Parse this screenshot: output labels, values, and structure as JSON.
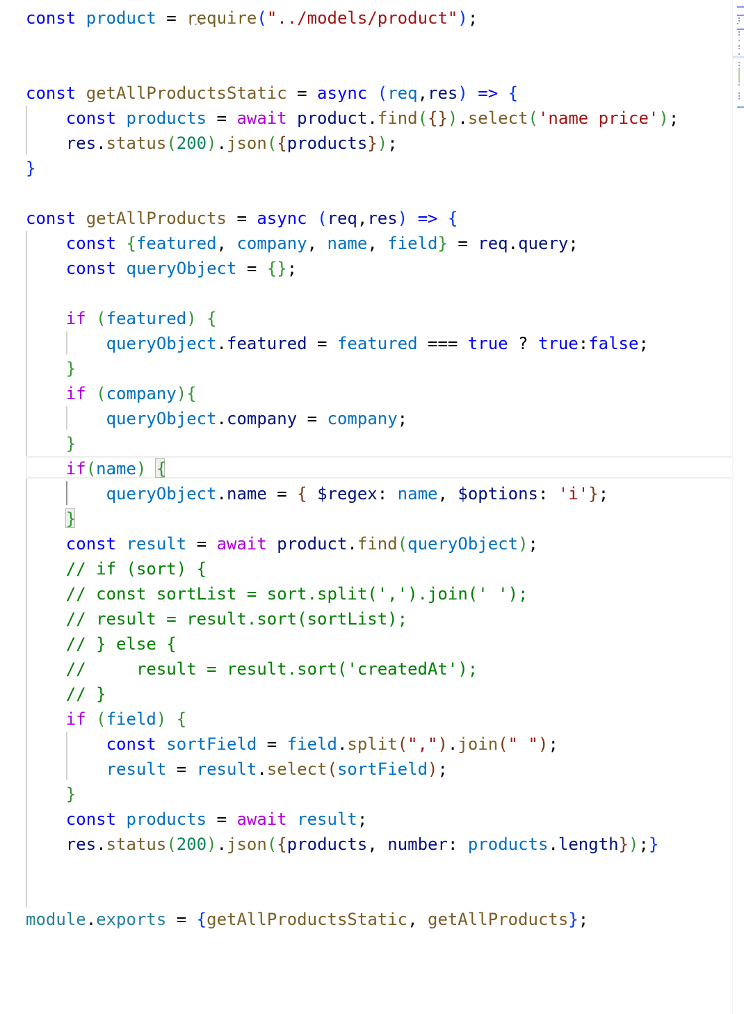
{
  "editor": {
    "language": "javascript",
    "theme_colors": {
      "keyword": "#0000ff",
      "control": "#af00db",
      "variable": "#0070c1",
      "property": "#001080",
      "function": "#795e26",
      "string": "#a31515",
      "number": "#098658",
      "comment": "#008000",
      "bracket_level1": "#0431fa",
      "bracket_level2": "#319331",
      "bracket_level3": "#7b3814",
      "module": "#267f99"
    },
    "hint_ellipsis": "...",
    "lines": [
      {
        "tokens": [
          [
            "kw",
            "const"
          ],
          [
            "p",
            " "
          ],
          [
            "var",
            "product"
          ],
          [
            "p",
            " = "
          ],
          [
            "fn",
            "require"
          ],
          [
            "br1",
            "("
          ],
          [
            "str",
            "\"../models/product\""
          ],
          [
            "br1",
            ")"
          ],
          [
            "p",
            ";"
          ]
        ]
      },
      {
        "tokens": []
      },
      {
        "tokens": []
      },
      {
        "tokens": [
          [
            "kw",
            "const"
          ],
          [
            "p",
            " "
          ],
          [
            "fn",
            "getAllProductsStatic"
          ],
          [
            "p",
            " = "
          ],
          [
            "kw",
            "async"
          ],
          [
            "p",
            " "
          ],
          [
            "br1",
            "("
          ],
          [
            "var",
            "req"
          ],
          [
            "p",
            ","
          ],
          [
            "vr2",
            "res"
          ],
          [
            "br1",
            ")"
          ],
          [
            "p",
            " "
          ],
          [
            "kw",
            "=>"
          ],
          [
            "p",
            " "
          ],
          [
            "br1",
            "{"
          ]
        ]
      },
      {
        "tokens": [
          [
            "p",
            "    "
          ],
          [
            "kw",
            "const"
          ],
          [
            "p",
            " "
          ],
          [
            "var",
            "products"
          ],
          [
            "p",
            " = "
          ],
          [
            "ctl",
            "await"
          ],
          [
            "p",
            " "
          ],
          [
            "vr2",
            "product"
          ],
          [
            "p",
            "."
          ],
          [
            "fn",
            "find"
          ],
          [
            "br2",
            "("
          ],
          [
            "br3",
            "{}"
          ],
          [
            "br2",
            ")"
          ],
          [
            "p",
            "."
          ],
          [
            "fn",
            "select"
          ],
          [
            "br2",
            "("
          ],
          [
            "str",
            "'name price'"
          ],
          [
            "br2",
            ")"
          ],
          [
            "p",
            ";"
          ]
        ]
      },
      {
        "tokens": [
          [
            "p",
            "    "
          ],
          [
            "vr2",
            "res"
          ],
          [
            "p",
            "."
          ],
          [
            "fn",
            "status"
          ],
          [
            "br2",
            "("
          ],
          [
            "num",
            "200"
          ],
          [
            "br2",
            ")"
          ],
          [
            "p",
            "."
          ],
          [
            "fn",
            "json"
          ],
          [
            "br2",
            "("
          ],
          [
            "br3",
            "{"
          ],
          [
            "vr2",
            "products"
          ],
          [
            "br3",
            "}"
          ],
          [
            "br2",
            ")"
          ],
          [
            "p",
            ";"
          ]
        ]
      },
      {
        "tokens": [
          [
            "br1",
            "}"
          ]
        ]
      },
      {
        "tokens": []
      },
      {
        "tokens": [
          [
            "kw",
            "const"
          ],
          [
            "p",
            " "
          ],
          [
            "fn",
            "getAllProducts"
          ],
          [
            "p",
            " = "
          ],
          [
            "kw",
            "async"
          ],
          [
            "p",
            " "
          ],
          [
            "br1",
            "("
          ],
          [
            "vr2",
            "req"
          ],
          [
            "p",
            ","
          ],
          [
            "vr2",
            "res"
          ],
          [
            "br1",
            ")"
          ],
          [
            "p",
            " "
          ],
          [
            "kw",
            "=>"
          ],
          [
            "p",
            " "
          ],
          [
            "br1",
            "{"
          ]
        ]
      },
      {
        "tokens": [
          [
            "p",
            "    "
          ],
          [
            "kw",
            "const"
          ],
          [
            "p",
            " "
          ],
          [
            "br2",
            "{"
          ],
          [
            "var",
            "featured"
          ],
          [
            "p",
            ", "
          ],
          [
            "var",
            "company"
          ],
          [
            "p",
            ", "
          ],
          [
            "var",
            "name"
          ],
          [
            "p",
            ", "
          ],
          [
            "var",
            "field"
          ],
          [
            "br2",
            "}"
          ],
          [
            "p",
            " = "
          ],
          [
            "vr2",
            "req"
          ],
          [
            "p",
            "."
          ],
          [
            "vr2",
            "query"
          ],
          [
            "p",
            ";"
          ]
        ]
      },
      {
        "tokens": [
          [
            "p",
            "    "
          ],
          [
            "kw",
            "const"
          ],
          [
            "p",
            " "
          ],
          [
            "var",
            "queryObject"
          ],
          [
            "p",
            " = "
          ],
          [
            "br2",
            "{}"
          ],
          [
            "p",
            ";"
          ]
        ]
      },
      {
        "tokens": []
      },
      {
        "tokens": [
          [
            "p",
            "    "
          ],
          [
            "ctl",
            "if"
          ],
          [
            "p",
            " "
          ],
          [
            "br2",
            "("
          ],
          [
            "var",
            "featured"
          ],
          [
            "br2",
            ")"
          ],
          [
            "p",
            " "
          ],
          [
            "br2",
            "{"
          ]
        ]
      },
      {
        "tokens": [
          [
            "p",
            "        "
          ],
          [
            "var",
            "queryObject"
          ],
          [
            "p",
            "."
          ],
          [
            "vr2",
            "featured"
          ],
          [
            "p",
            " = "
          ],
          [
            "var",
            "featured"
          ],
          [
            "p",
            " === "
          ],
          [
            "kw",
            "true"
          ],
          [
            "p",
            " ? "
          ],
          [
            "kw",
            "true"
          ],
          [
            "p",
            ":"
          ],
          [
            "kw",
            "false"
          ],
          [
            "p",
            ";"
          ]
        ]
      },
      {
        "tokens": [
          [
            "p",
            "    "
          ],
          [
            "br2",
            "}"
          ]
        ]
      },
      {
        "tokens": [
          [
            "p",
            "    "
          ],
          [
            "ctl",
            "if"
          ],
          [
            "p",
            " "
          ],
          [
            "br2",
            "("
          ],
          [
            "var",
            "company"
          ],
          [
            "br2",
            ")"
          ],
          [
            "br2",
            "{"
          ]
        ]
      },
      {
        "tokens": [
          [
            "p",
            "        "
          ],
          [
            "var",
            "queryObject"
          ],
          [
            "p",
            "."
          ],
          [
            "vr2",
            "company"
          ],
          [
            "p",
            " = "
          ],
          [
            "var",
            "company"
          ],
          [
            "p",
            ";"
          ]
        ]
      },
      {
        "tokens": [
          [
            "p",
            "    "
          ],
          [
            "br2",
            "}"
          ]
        ]
      },
      {
        "tokens": [
          [
            "p",
            "    "
          ],
          [
            "ctl",
            "if"
          ],
          [
            "br2",
            "("
          ],
          [
            "var",
            "name"
          ],
          [
            "br2",
            ")"
          ],
          [
            "p",
            " "
          ],
          [
            "br2",
            "{"
          ]
        ]
      },
      {
        "tokens": [
          [
            "p",
            "        "
          ],
          [
            "var",
            "queryObject"
          ],
          [
            "p",
            "."
          ],
          [
            "vr2",
            "name"
          ],
          [
            "p",
            " = "
          ],
          [
            "br3",
            "{"
          ],
          [
            "p",
            " "
          ],
          [
            "vr2",
            "$regex"
          ],
          [
            "p",
            ": "
          ],
          [
            "var",
            "name"
          ],
          [
            "p",
            ", "
          ],
          [
            "vr2",
            "$options"
          ],
          [
            "p",
            ": "
          ],
          [
            "str",
            "'i'"
          ],
          [
            "br3",
            "}"
          ],
          [
            "p",
            ";"
          ]
        ]
      },
      {
        "tokens": [
          [
            "p",
            "    "
          ],
          [
            "br2",
            "}"
          ]
        ]
      },
      {
        "tokens": [
          [
            "p",
            "    "
          ],
          [
            "kw",
            "const"
          ],
          [
            "p",
            " "
          ],
          [
            "var",
            "result"
          ],
          [
            "p",
            " = "
          ],
          [
            "ctl",
            "await"
          ],
          [
            "p",
            " "
          ],
          [
            "vr2",
            "product"
          ],
          [
            "p",
            "."
          ],
          [
            "fn",
            "find"
          ],
          [
            "br2",
            "("
          ],
          [
            "var",
            "queryObject"
          ],
          [
            "br2",
            ")"
          ],
          [
            "p",
            ";"
          ]
        ]
      },
      {
        "tokens": [
          [
            "p",
            "    "
          ],
          [
            "cmt",
            "// if (sort) {"
          ]
        ]
      },
      {
        "tokens": [
          [
            "p",
            "    "
          ],
          [
            "cmt",
            "// const sortList = sort.split(',').join(' ');"
          ]
        ]
      },
      {
        "tokens": [
          [
            "p",
            "    "
          ],
          [
            "cmt",
            "// result = result.sort(sortList);"
          ]
        ]
      },
      {
        "tokens": [
          [
            "p",
            "    "
          ],
          [
            "cmt",
            "// } else {"
          ]
        ]
      },
      {
        "tokens": [
          [
            "p",
            "    "
          ],
          [
            "cmt",
            "//     result = result.sort('createdAt');"
          ]
        ]
      },
      {
        "tokens": [
          [
            "p",
            "    "
          ],
          [
            "cmt",
            "// }"
          ]
        ]
      },
      {
        "tokens": [
          [
            "p",
            "    "
          ],
          [
            "ctl",
            "if"
          ],
          [
            "p",
            " "
          ],
          [
            "br2",
            "("
          ],
          [
            "var",
            "field"
          ],
          [
            "br2",
            ")"
          ],
          [
            "p",
            " "
          ],
          [
            "br2",
            "{"
          ]
        ]
      },
      {
        "tokens": [
          [
            "p",
            "        "
          ],
          [
            "kw",
            "const"
          ],
          [
            "p",
            " "
          ],
          [
            "var",
            "sortField"
          ],
          [
            "p",
            " = "
          ],
          [
            "var",
            "field"
          ],
          [
            "p",
            "."
          ],
          [
            "fn",
            "split"
          ],
          [
            "br3",
            "("
          ],
          [
            "str",
            "\",\""
          ],
          [
            "br3",
            ")"
          ],
          [
            "p",
            "."
          ],
          [
            "fn",
            "join"
          ],
          [
            "br3",
            "("
          ],
          [
            "str",
            "\" \""
          ],
          [
            "br3",
            ")"
          ],
          [
            "p",
            ";"
          ]
        ]
      },
      {
        "tokens": [
          [
            "p",
            "        "
          ],
          [
            "var",
            "result"
          ],
          [
            "p",
            " = "
          ],
          [
            "var",
            "result"
          ],
          [
            "p",
            "."
          ],
          [
            "fn",
            "select"
          ],
          [
            "br3",
            "("
          ],
          [
            "var",
            "sortField"
          ],
          [
            "br3",
            ")"
          ],
          [
            "p",
            ";"
          ]
        ]
      },
      {
        "tokens": [
          [
            "p",
            "    "
          ],
          [
            "br2",
            "}"
          ]
        ]
      },
      {
        "tokens": [
          [
            "p",
            "    "
          ],
          [
            "kw",
            "const"
          ],
          [
            "p",
            " "
          ],
          [
            "var",
            "products"
          ],
          [
            "p",
            " = "
          ],
          [
            "ctl",
            "await"
          ],
          [
            "p",
            " "
          ],
          [
            "var",
            "result"
          ],
          [
            "p",
            ";"
          ]
        ]
      },
      {
        "tokens": [
          [
            "p",
            "    "
          ],
          [
            "vr2",
            "res"
          ],
          [
            "p",
            "."
          ],
          [
            "fn",
            "status"
          ],
          [
            "br2",
            "("
          ],
          [
            "num",
            "200"
          ],
          [
            "br2",
            ")"
          ],
          [
            "p",
            "."
          ],
          [
            "fn",
            "json"
          ],
          [
            "br2",
            "("
          ],
          [
            "br3",
            "{"
          ],
          [
            "vr2",
            "products"
          ],
          [
            "p",
            ", "
          ],
          [
            "vr2",
            "number"
          ],
          [
            "p",
            ": "
          ],
          [
            "var",
            "products"
          ],
          [
            "p",
            "."
          ],
          [
            "vr2",
            "length"
          ],
          [
            "br3",
            "}"
          ],
          [
            "br2",
            ")"
          ],
          [
            "p",
            ";"
          ],
          [
            "br1",
            "}"
          ]
        ]
      },
      {
        "tokens": []
      },
      {
        "tokens": []
      },
      {
        "tokens": [
          [
            "mod",
            "module"
          ],
          [
            "p",
            "."
          ],
          [
            "mod",
            "exports"
          ],
          [
            "p",
            " = "
          ],
          [
            "br1",
            "{"
          ],
          [
            "fn",
            "getAllProductsStatic"
          ],
          [
            "p",
            ", "
          ],
          [
            "fn",
            "getAllProducts"
          ],
          [
            "br1",
            "}"
          ],
          [
            "p",
            ";"
          ]
        ]
      }
    ]
  }
}
